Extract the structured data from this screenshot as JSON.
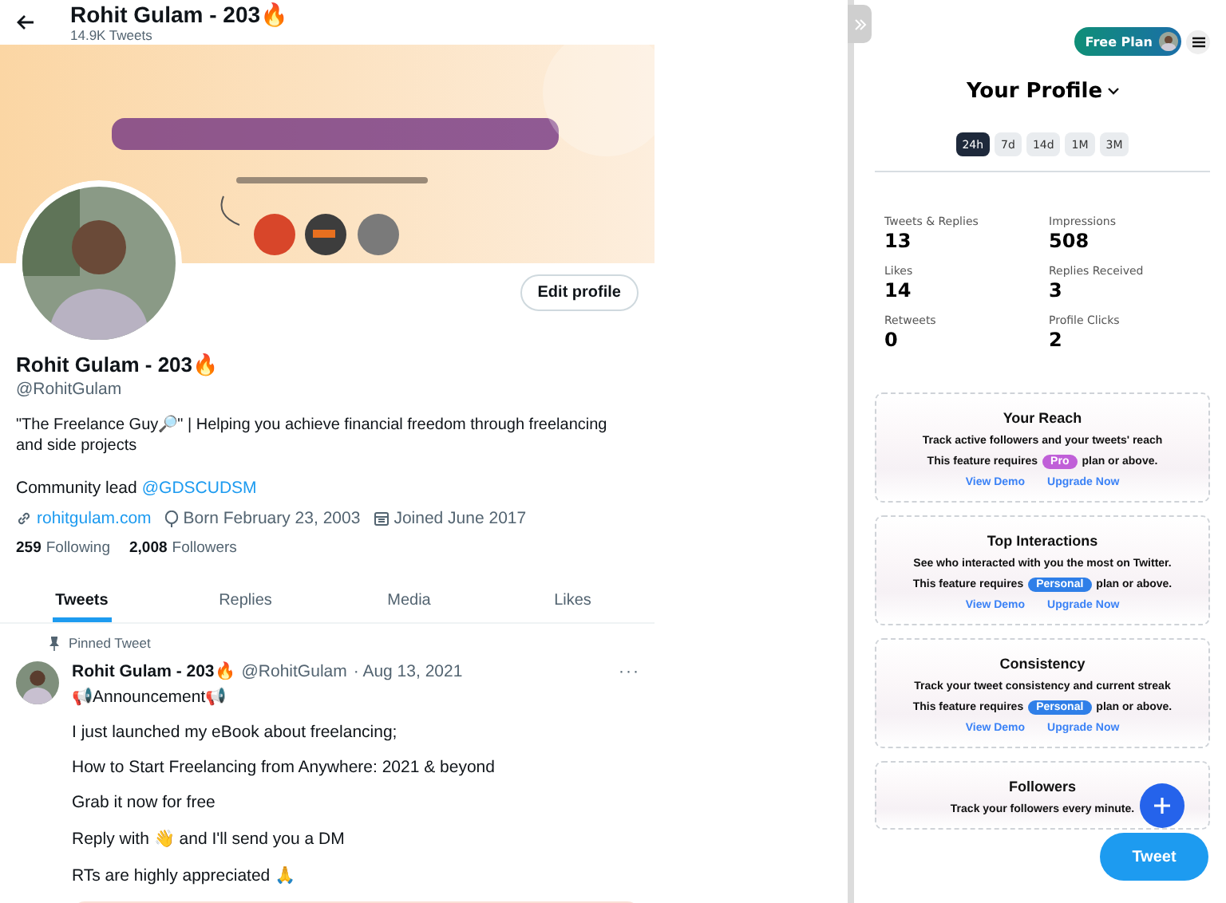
{
  "header": {
    "title": "Rohit Gulam - 203🔥",
    "subtitle": "14.9K Tweets"
  },
  "profile": {
    "edit_button": "Edit profile",
    "name": "Rohit Gulam - 203🔥",
    "handle": "@RohitGulam",
    "bio": "\"The Freelance Guy🔎\" | Helping you achieve financial freedom through freelancing and side projects",
    "community_text": "Community lead",
    "community_link": "@GDSCUDSM",
    "website": "rohitgulam.com",
    "birthday": "Born February 23, 2003",
    "joined": "Joined June 2017",
    "stats": [
      {
        "count": "259",
        "label": "Following"
      },
      {
        "count": "2,008",
        "label": "Followers"
      }
    ]
  },
  "tabs": [
    {
      "label": "Tweets",
      "selected": true
    },
    {
      "label": "Replies",
      "selected": false
    },
    {
      "label": "Media",
      "selected": false
    },
    {
      "label": "Likes",
      "selected": false
    }
  ],
  "pinned_tweet": {
    "label": "Pinned Tweet",
    "author": "Rohit Gulam - 203🔥",
    "handle": "@RohitGulam",
    "date": "· Aug 13, 2021",
    "more": "···",
    "lines": [
      "📢Announcement📢",
      "I just launched my eBook about freelancing;",
      "How to Start Freelancing from Anywhere: 2021 & beyond",
      "Grab it now for free",
      "Reply with 👋 and I'll send you a DM",
      "RTs are highly appreciated 🙏"
    ]
  },
  "panel": {
    "plan_badge": "Free Plan",
    "title": "Your Profile",
    "periods": [
      {
        "label": "24h",
        "selected": true
      },
      {
        "label": "7d",
        "selected": false
      },
      {
        "label": "14d",
        "selected": false
      },
      {
        "label": "1M",
        "selected": false
      },
      {
        "label": "3M",
        "selected": false
      }
    ],
    "stats": [
      {
        "label": "Tweets & Replies",
        "value": "13"
      },
      {
        "label": "Impressions",
        "value": "508"
      },
      {
        "label": "Likes",
        "value": "14"
      },
      {
        "label": "Replies Received",
        "value": "3"
      },
      {
        "label": "Retweets",
        "value": "0"
      },
      {
        "label": "Profile Clicks",
        "value": "2"
      }
    ],
    "cards": [
      {
        "title": "Your Reach",
        "description": "Track active followers and your tweets' reach",
        "requirement_prefix": "This feature requires",
        "plan": "Pro",
        "color": "#c05fd8",
        "requirement_suffix": "plan or above.",
        "links": [
          "View Demo",
          "Upgrade Now"
        ]
      },
      {
        "title": "Top Interactions",
        "description": "See who interacted with you the most on Twitter.",
        "requirement_prefix": "This feature requires",
        "plan": "Personal",
        "color": "#2f7fe8",
        "requirement_suffix": "plan or above.",
        "links": [
          "View Demo",
          "Upgrade Now"
        ]
      },
      {
        "title": "Consistency",
        "description": "Track your tweet consistency and current streak",
        "requirement_prefix": "This feature requires",
        "plan": "Personal",
        "color": "#2f7fe8",
        "requirement_suffix": "plan or above.",
        "links": [
          "View Demo",
          "Upgrade Now"
        ]
      },
      {
        "title": "Followers",
        "description": "Track your followers every minute."
      }
    ],
    "tweet_button": "Tweet"
  }
}
